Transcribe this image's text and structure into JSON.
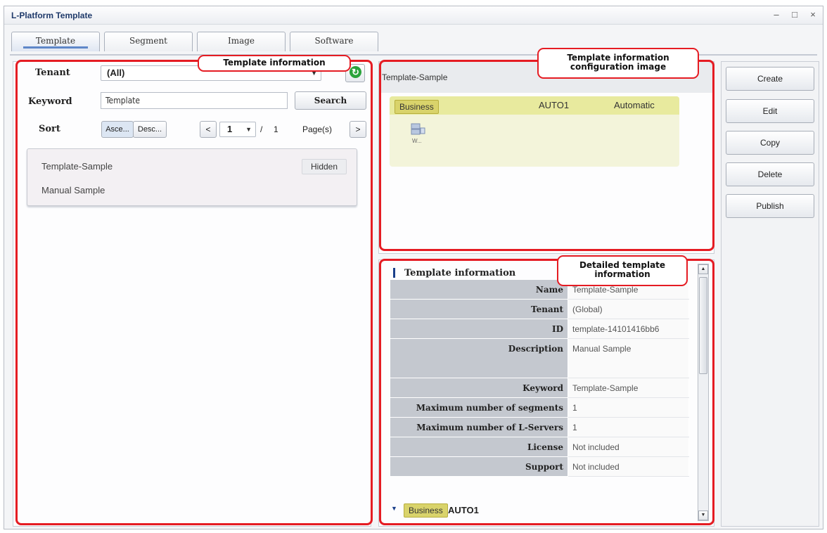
{
  "window": {
    "title": "L-Platform Template",
    "controls": [
      "–",
      "□",
      "×"
    ]
  },
  "tabs": [
    {
      "label": "Template",
      "active": true
    },
    {
      "label": "Segment",
      "active": false
    },
    {
      "label": "Image",
      "active": false
    },
    {
      "label": "Software",
      "active": false
    }
  ],
  "callouts": {
    "template_info": "Template information",
    "config_image": "Template information configuration image",
    "detailed_info": "Detailed template information"
  },
  "filter": {
    "tenant_label": "Tenant",
    "tenant_value": "(All)",
    "keyword_label": "Keyword",
    "keyword_value": "Template",
    "search_label": "Search",
    "sort_label": "Sort",
    "sort_asc": "Asce...",
    "sort_desc": "Desc...",
    "prev": "<",
    "next": ">",
    "page_current": "1",
    "page_sep": "/",
    "page_total": "1",
    "pages_label": "Page(s)"
  },
  "template_list": [
    {
      "name": "Template-Sample",
      "badge": "Hidden"
    },
    {
      "name": "Manual Sample",
      "badge": ""
    }
  ],
  "config_image": {
    "template_name": "Template-Sample",
    "segment_type": "Business",
    "segment_name": "AUTO1",
    "segment_mode": "Automatic",
    "server_label": "W..."
  },
  "details": {
    "heading": "Template information",
    "rows": [
      {
        "key": "Name",
        "value": "Template-Sample"
      },
      {
        "key": "Tenant",
        "value": "(Global)"
      },
      {
        "key": "ID",
        "value": "template-14101416bb6"
      },
      {
        "key": "Description",
        "value": "Manual Sample"
      },
      {
        "key": "Keyword",
        "value": "Template-Sample"
      },
      {
        "key": "Maximum number of segments",
        "value": "1"
      },
      {
        "key": "Maximum number of L-Servers",
        "value": "1"
      },
      {
        "key": "License",
        "value": "Not included"
      },
      {
        "key": "Support",
        "value": "Not included"
      }
    ],
    "segment_badge": "Business",
    "segment_name": "AUTO1"
  },
  "actions": [
    "Create",
    "Edit",
    "Copy",
    "Delete",
    "Publish"
  ],
  "colors": {
    "highlight_frame": "#e51c23",
    "business_badge": "#d9d36b",
    "refresh": "#2aa33b"
  }
}
